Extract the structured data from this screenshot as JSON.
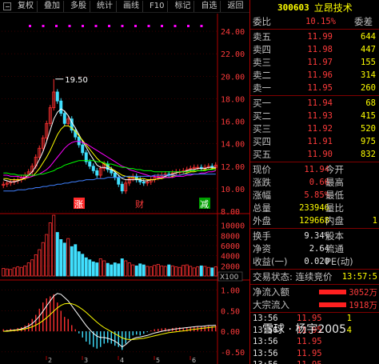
{
  "toolbar": {
    "buttons": [
      "复权",
      "叠加",
      "多股",
      "统计",
      "画线",
      "F10",
      "标记",
      "自选",
      "返回"
    ]
  },
  "chart": {
    "price_axis": [
      "24.00",
      "22.00",
      "20.00",
      "18.00",
      "16.00",
      "14.00",
      "12.00",
      "10.00",
      "8.00"
    ],
    "peak_label": "19.50",
    "markers": [
      "涨",
      "财",
      "减"
    ],
    "volume_axis": [
      "10000",
      "8000",
      "6000",
      "4000",
      "2000"
    ],
    "volume_unit": "X100",
    "macd_axis": [
      "1.00",
      "0.50",
      "0.00",
      "-0.50"
    ],
    "macd_ticks": [
      "2",
      "3",
      "4",
      "5",
      "6"
    ]
  },
  "chart_data": {
    "type": "candlestick",
    "price_series": {
      "close": [
        10.4,
        10.5,
        10.6,
        10.7,
        10.8,
        11.0,
        11.2,
        11.5,
        12.0,
        12.8,
        13.6,
        14.5,
        15.8,
        17.2,
        18.6,
        17.8,
        16.7,
        15.8,
        16.2,
        15.2,
        14.6,
        13.9,
        13.2,
        12.4,
        12.0,
        11.6,
        11.2,
        11.8,
        12.2,
        11.7,
        11.4,
        11.0,
        10.4,
        9.8,
        10.5,
        10.9,
        11.1,
        10.8,
        10.6,
        10.5,
        10.6,
        10.8,
        11.0,
        11.1,
        11.2,
        11.3,
        11.2,
        11.4,
        11.5,
        11.5,
        11.6,
        11.7,
        11.8,
        11.9,
        11.9,
        11.8,
        11.9,
        12.0,
        11.9,
        12.1
      ],
      "ma": [
        {
          "color": "#ffffff",
          "values": [
            10.8,
            10.7,
            10.6,
            10.6,
            10.7,
            10.8,
            11.0,
            11.2,
            11.5,
            12.0,
            12.6,
            13.3,
            14.2,
            15.2,
            16.2,
            16.8,
            17.1,
            16.9,
            16.5,
            15.9,
            15.4,
            14.8,
            14.2,
            13.7,
            13.1,
            12.6,
            12.1,
            11.9,
            11.9,
            11.8,
            11.7,
            11.5,
            11.2,
            10.9,
            10.8,
            10.8,
            10.8,
            10.8,
            10.8,
            10.7,
            10.7,
            10.8,
            10.8,
            10.9,
            11.0,
            11.1,
            11.2,
            11.3,
            11.4,
            11.5,
            11.5,
            11.6,
            11.7,
            11.7,
            11.8,
            11.8,
            11.8,
            11.9,
            11.9,
            11.9
          ]
        },
        {
          "color": "#ffff00",
          "values": [
            10.9,
            10.9,
            10.8,
            10.8,
            10.8,
            10.8,
            10.9,
            11.0,
            11.1,
            11.4,
            11.8,
            12.3,
            12.8,
            13.4,
            14.1,
            14.8,
            15.3,
            15.6,
            15.6,
            15.4,
            15.1,
            14.7,
            14.3,
            13.9,
            13.5,
            13.1,
            12.7,
            12.4,
            12.2,
            12.0,
            11.8,
            11.6,
            11.4,
            11.2,
            11.1,
            11.0,
            11.0,
            10.9,
            10.9,
            10.9,
            10.8,
            10.8,
            10.8,
            10.9,
            10.9,
            11.0,
            11.0,
            11.1,
            11.2,
            11.2,
            11.3,
            11.4,
            11.5,
            11.5,
            11.6,
            11.6,
            11.7,
            11.7,
            11.8,
            11.8
          ]
        },
        {
          "color": "#ff00ff",
          "values": [
            11.2,
            11.2,
            11.1,
            11.1,
            11.1,
            11.0,
            11.0,
            11.0,
            11.1,
            11.2,
            11.3,
            11.5,
            11.7,
            12.0,
            12.4,
            12.8,
            13.2,
            13.6,
            13.9,
            14.1,
            14.2,
            14.2,
            14.1,
            14.0,
            13.8,
            13.6,
            13.4,
            13.2,
            13.0,
            12.8,
            12.6,
            12.4,
            12.2,
            12.0,
            11.9,
            11.7,
            11.6,
            11.5,
            11.4,
            11.3,
            11.2,
            11.1,
            11.1,
            11.0,
            11.0,
            11.0,
            11.0,
            11.0,
            11.1,
            11.1,
            11.1,
            11.2,
            11.2,
            11.3,
            11.3,
            11.4,
            11.4,
            11.5,
            11.5,
            11.6
          ]
        },
        {
          "color": "#00ff00",
          "values": [
            11.4,
            11.4,
            11.3,
            11.3,
            11.2,
            11.2,
            11.2,
            11.2,
            11.2,
            11.2,
            11.3,
            11.3,
            11.4,
            11.5,
            11.6,
            11.8,
            11.9,
            12.1,
            12.2,
            12.3,
            12.4,
            12.5,
            12.5,
            12.5,
            12.5,
            12.5,
            12.4,
            12.4,
            12.3,
            12.2,
            12.2,
            12.1,
            12.0,
            11.9,
            11.9,
            11.8,
            11.8,
            11.7,
            11.7,
            11.6,
            11.6,
            11.6,
            11.5,
            11.5,
            11.5,
            11.5,
            11.5,
            11.5,
            11.5,
            11.5,
            11.5,
            11.5,
            11.6,
            11.6,
            11.6,
            11.6,
            11.6,
            11.7,
            11.7,
            11.7
          ]
        },
        {
          "color": "#4080ff",
          "values": [
            9.8,
            9.8,
            9.8,
            9.8,
            9.9,
            9.9,
            9.9,
            10.0,
            10.0,
            10.1,
            10.1,
            10.2,
            10.2,
            10.3,
            10.3,
            10.4,
            10.4,
            10.5,
            10.5,
            10.6,
            10.6,
            10.7,
            10.7,
            10.8,
            10.8,
            10.8,
            10.9,
            10.9,
            10.9,
            11.0,
            11.0,
            11.0,
            11.0,
            11.0,
            11.1,
            11.1,
            11.1,
            11.1,
            11.1,
            11.1,
            11.1,
            11.1,
            11.2,
            11.2,
            11.2,
            11.2,
            11.2,
            11.2,
            11.2,
            11.2,
            11.3,
            11.3,
            11.3,
            11.3,
            11.3,
            11.3,
            11.3,
            11.3,
            11.3,
            11.3
          ]
        }
      ],
      "y_range": [
        8,
        25
      ]
    },
    "volume": {
      "values": [
        1500,
        1400,
        1300,
        1600,
        1800,
        1700,
        2000,
        2600,
        3200,
        4200,
        5200,
        6600,
        8200,
        10500,
        12000,
        8600,
        7200,
        6500,
        7400,
        5800,
        6200,
        4800,
        4300,
        3600,
        3200,
        2800,
        2600,
        3400,
        3000,
        2500,
        2200,
        2600,
        2400,
        3400,
        3000,
        2600,
        2200,
        2000,
        2400,
        2200,
        1900,
        1800,
        2100,
        2300,
        2000,
        1900,
        2200,
        2000,
        1800,
        1700,
        2100,
        2200,
        1900,
        1600,
        1800,
        2000,
        1900,
        1700,
        1600,
        1800
      ],
      "y_range": [
        0,
        12000
      ]
    },
    "macd": {
      "histogram": [
        0.05,
        0.04,
        0.06,
        0.05,
        0.08,
        0.1,
        0.14,
        0.2,
        0.3,
        0.4,
        0.55,
        0.7,
        0.8,
        0.85,
        0.9,
        0.7,
        0.5,
        0.35,
        0.3,
        0.15,
        0.05,
        -0.05,
        -0.15,
        -0.25,
        -0.32,
        -0.38,
        -0.42,
        -0.38,
        -0.3,
        -0.28,
        -0.3,
        -0.35,
        -0.38,
        -0.45,
        -0.3,
        -0.18,
        -0.1,
        -0.08,
        -0.1,
        -0.06,
        -0.02,
        0.02,
        0.05,
        0.06,
        0.07,
        0.08,
        0.06,
        0.08,
        0.09,
        0.1,
        0.09,
        0.1,
        0.11,
        0.12,
        0.12,
        0.11,
        0.12,
        0.13,
        0.12,
        0.14
      ],
      "dif": [
        0.0,
        0.01,
        0.02,
        0.03,
        0.04,
        0.06,
        0.09,
        0.13,
        0.19,
        0.27,
        0.37,
        0.49,
        0.62,
        0.74,
        0.86,
        0.92,
        0.9,
        0.82,
        0.74,
        0.62,
        0.5,
        0.38,
        0.26,
        0.14,
        0.04,
        -0.05,
        -0.12,
        -0.15,
        -0.15,
        -0.17,
        -0.2,
        -0.24,
        -0.3,
        -0.38,
        -0.32,
        -0.24,
        -0.18,
        -0.15,
        -0.14,
        -0.12,
        -0.1,
        -0.07,
        -0.04,
        -0.02,
        0.0,
        0.02,
        0.03,
        0.05,
        0.06,
        0.07,
        0.08,
        0.09,
        0.1,
        0.11,
        0.12,
        0.12,
        0.13,
        0.14,
        0.14,
        0.15
      ],
      "dea": [
        0.0,
        0.0,
        0.01,
        0.02,
        0.03,
        0.04,
        0.06,
        0.08,
        0.11,
        0.15,
        0.2,
        0.26,
        0.33,
        0.41,
        0.49,
        0.57,
        0.63,
        0.67,
        0.68,
        0.67,
        0.64,
        0.59,
        0.53,
        0.46,
        0.38,
        0.3,
        0.22,
        0.15,
        0.09,
        0.04,
        -0.01,
        -0.06,
        -0.11,
        -0.16,
        -0.19,
        -0.2,
        -0.2,
        -0.19,
        -0.18,
        -0.17,
        -0.15,
        -0.13,
        -0.11,
        -0.09,
        -0.07,
        -0.05,
        -0.03,
        -0.02,
        -0.01,
        0.0,
        0.01,
        0.02,
        0.04,
        0.05,
        0.06,
        0.07,
        0.08,
        0.09,
        0.1,
        0.11
      ],
      "y_range": [
        -0.6,
        1.15
      ]
    }
  },
  "quote": {
    "code": "300603",
    "name": "立昂技术",
    "weibi_label": "委比",
    "weibi_value": "10.15%",
    "weicha_label": "委差",
    "sell": [
      {
        "label": "卖五",
        "price": "11.99",
        "vol": "644"
      },
      {
        "label": "卖四",
        "price": "11.98",
        "vol": "447"
      },
      {
        "label": "卖三",
        "price": "11.97",
        "vol": "155"
      },
      {
        "label": "卖二",
        "price": "11.96",
        "vol": "314"
      },
      {
        "label": "卖一",
        "price": "11.95",
        "vol": "260"
      }
    ],
    "buy": [
      {
        "label": "买一",
        "price": "11.94",
        "vol": "68"
      },
      {
        "label": "买二",
        "price": "11.93",
        "vol": "415"
      },
      {
        "label": "买三",
        "price": "11.92",
        "vol": "520"
      },
      {
        "label": "买四",
        "price": "11.91",
        "vol": "975"
      },
      {
        "label": "买五",
        "price": "11.90",
        "vol": "832"
      }
    ],
    "stats": [
      {
        "l1": "现价",
        "v1": "11.94",
        "l2": "今开"
      },
      {
        "l1": "涨跌",
        "v1": "0.66",
        "l2": "最高"
      },
      {
        "l1": "涨幅",
        "v1": "5.85%",
        "l2": "最低"
      },
      {
        "l1": "总量",
        "v1": "233946",
        "l2": "量比"
      },
      {
        "l1": "外盘",
        "v1": "129668",
        "l2": "内盘",
        "v2": "1"
      }
    ],
    "stats2": [
      {
        "l1": "换手",
        "v1": "9.34%",
        "l2": "股本"
      },
      {
        "l1": "净资",
        "v1": "2.64",
        "l2": "流通"
      },
      {
        "l1": "收益(一)",
        "v1": "0.020",
        "l2": "PE(动)"
      }
    ],
    "trade_status": "交易状态: 连续竞价",
    "trade_time": "13:57:5",
    "flows": [
      {
        "label": "净流入额",
        "value": "3052万"
      },
      {
        "label": "大宗流入",
        "value": "1918万"
      }
    ],
    "ticks": [
      {
        "time": "13:56",
        "price": "11.95",
        "vol": "1"
      },
      {
        "time": "13:56",
        "price": "11.95",
        "vol": "4"
      },
      {
        "time": "13:56",
        "price": "11.95",
        "vol": ""
      },
      {
        "time": "13:56",
        "price": "11.95",
        "vol": ""
      },
      {
        "time": "13:56",
        "price": "11.95",
        "vol": ""
      }
    ]
  },
  "watermark": "雪球 · 杨宇2005"
}
